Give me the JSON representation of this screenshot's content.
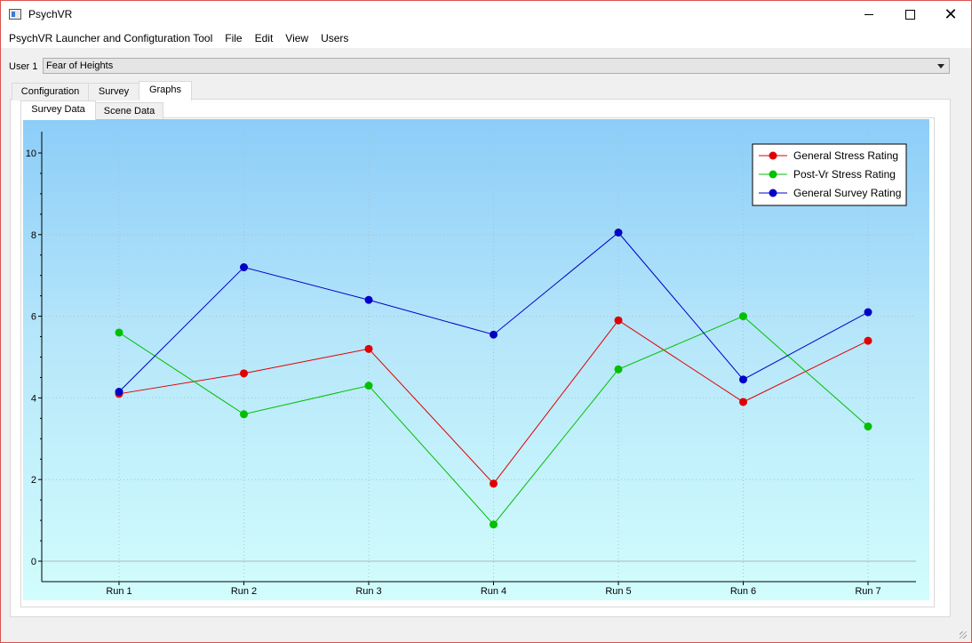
{
  "window": {
    "title": "PsychVR"
  },
  "menu": {
    "items": [
      "PsychVR Launcher and Configturation Tool",
      "File",
      "Edit",
      "View",
      "Users"
    ]
  },
  "user": {
    "label": "User 1",
    "selected": "Fear of Heights"
  },
  "tabs": {
    "outer": [
      {
        "label": "Configuration"
      },
      {
        "label": "Survey"
      },
      {
        "label": "Graphs",
        "active": true
      }
    ],
    "inner": [
      {
        "label": "Survey Data",
        "active": true
      },
      {
        "label": "Scene Data"
      }
    ]
  },
  "chart_data": {
    "type": "line",
    "categories": [
      "Run 1",
      "Run 2",
      "Run 3",
      "Run 4",
      "Run 5",
      "Run 6",
      "Run 7"
    ],
    "ylim": [
      0,
      10.5
    ],
    "yticks": [
      0,
      2,
      4,
      6,
      8,
      10
    ],
    "grid": true,
    "legend_position": "top-right",
    "series": [
      {
        "name": "General Stress Rating",
        "color": "#e00000",
        "values": [
          4.1,
          4.6,
          5.2,
          1.9,
          5.9,
          3.9,
          5.4
        ]
      },
      {
        "name": "Post-Vr Stress Rating",
        "color": "#00c000",
        "values": [
          5.6,
          3.6,
          4.3,
          0.9,
          4.7,
          6.0,
          3.3
        ]
      },
      {
        "name": "General Survey Rating",
        "color": "#0000c8",
        "values": [
          4.15,
          7.2,
          6.4,
          5.55,
          8.05,
          4.45,
          6.1
        ]
      }
    ]
  }
}
